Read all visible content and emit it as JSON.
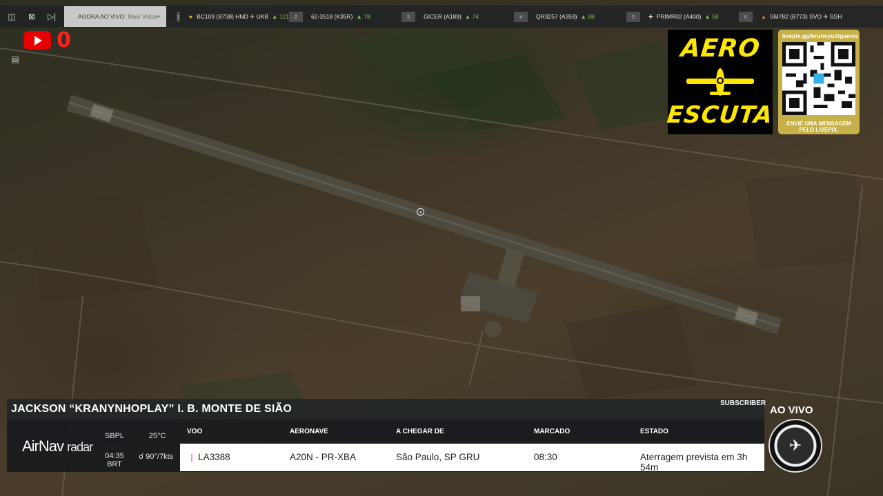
{
  "tabbar": {
    "live_prefix": "AGORA AO VIVO:",
    "live_value": "Mais Vistos",
    "flights": [
      {
        "num": "1",
        "icon": "★",
        "route_text": "BC109 (B738)  HND ✈ UKB",
        "count": "121"
      },
      {
        "num": "2",
        "icon": "",
        "route_text": "62-3518 (K35R)",
        "count": "78"
      },
      {
        "num": "3",
        "icon": "",
        "route_text": "GICER (A189)",
        "count": "74"
      },
      {
        "num": "4",
        "icon": "",
        "route_text": "QR3257 (A359)",
        "count": "88"
      },
      {
        "num": "5",
        "icon": "✚",
        "route_text": "PRIMR02 (A400)",
        "count": "58"
      },
      {
        "num": "6",
        "icon": "▲",
        "route_text": "SM782 (B773)  SVO ✈ SSH",
        "count": ""
      }
    ]
  },
  "youtube": {
    "count": "0"
  },
  "aero": {
    "line1": "AERO",
    "line2": "ESCUTA"
  },
  "livepix": {
    "url": "livepix.gg/brunoyudigames",
    "message": "ENVIE UMA MENSAGEM PELO LIVEPIX."
  },
  "stream": {
    "subscriber_label": "SUBSCRIBER",
    "title": "JACKSON “KRANYNHOPLAY” I. B. MONTE DE SIÃO",
    "ao_vivo": "AO VIVO"
  },
  "airnav": {
    "brand": "AirNav",
    "brand_suffix": "radar",
    "airport": "SBPL",
    "temperature": "25°C",
    "time": "04:35 BRT",
    "wind": "90°/7kts",
    "headers": {
      "flight": "VOO",
      "aircraft": "AERONAVE",
      "from": "A CHEGAR DE",
      "scheduled": "MARCADO",
      "status": "ESTADO"
    },
    "row": {
      "flight": "LA3388",
      "aircraft": "A20N - PR-XBA",
      "from": "São Paulo, SP GRU",
      "scheduled": "08:30",
      "status": "Aterragem prevista em 3h 54m"
    }
  },
  "colors": {
    "youtube_red": "#e60000",
    "aero_yellow": "#ffe600",
    "livepix_gold": "#c6b04a"
  },
  "icons": [
    "sidebar-toggle-icon",
    "close-window-icon",
    "skip-next-icon",
    "chevron-down-icon",
    "star-icon",
    "plane-icon",
    "map-pin-icon",
    "list-icon"
  ]
}
